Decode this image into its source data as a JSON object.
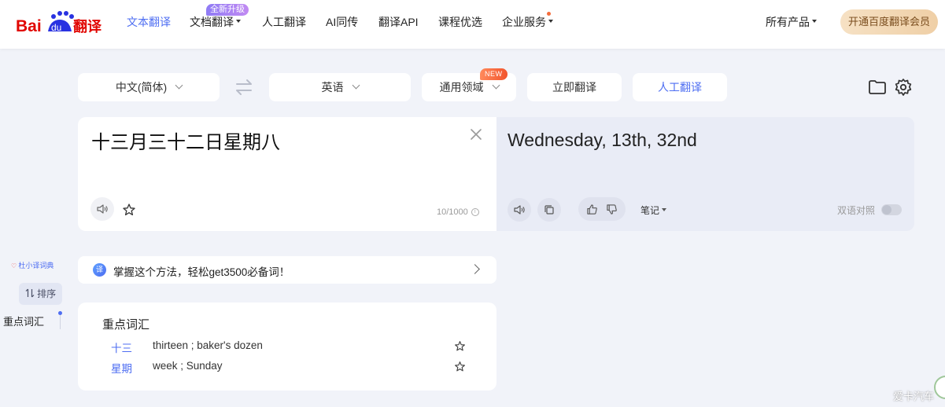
{
  "header": {
    "logo_text": "Bai du 翻译",
    "nav": [
      {
        "label": "文本翻译",
        "active": true
      },
      {
        "label": "文档翻译",
        "badge": "全新升级"
      },
      {
        "label": "人工翻译"
      },
      {
        "label": "AI同传"
      },
      {
        "label": "翻译API"
      },
      {
        "label": "课程优选"
      },
      {
        "label": "企业服务"
      }
    ],
    "all_products": "所有产品",
    "vip_button": "开通百度翻译会员"
  },
  "toolbar": {
    "source_lang": "中文(简体)",
    "target_lang": "英语",
    "domain": "通用领域",
    "domain_badge": "NEW",
    "translate_button": "立即翻译",
    "human_translate_button": "人工翻译"
  },
  "source": {
    "text": "十三月三十二日星期八",
    "char_count": "10/1000"
  },
  "target": {
    "text": "Wednesday, 13th, 32nd",
    "notes_label": "笔记",
    "bilingual_label": "双语对照",
    "bilingual_on": false
  },
  "sidebar": {
    "dict_tag": "杜小译词典",
    "sort_label": "排序",
    "nav_vocab": "重点词汇"
  },
  "tip": {
    "icon_text": "译",
    "text": "掌握这个方法，轻松get3500必备词！"
  },
  "vocab": {
    "title": "重点词汇",
    "items": [
      {
        "word": "十三",
        "def": "thirteen ; baker's dozen"
      },
      {
        "word": "星期",
        "def": "week ; Sunday"
      }
    ]
  },
  "watermark": "爱卡汽车",
  "colors": {
    "accent": "#4e6ef2",
    "vip_bg": "#efcfa6",
    "new_badge": "#f2542d",
    "upgrade_badge": "#a47ff4"
  }
}
